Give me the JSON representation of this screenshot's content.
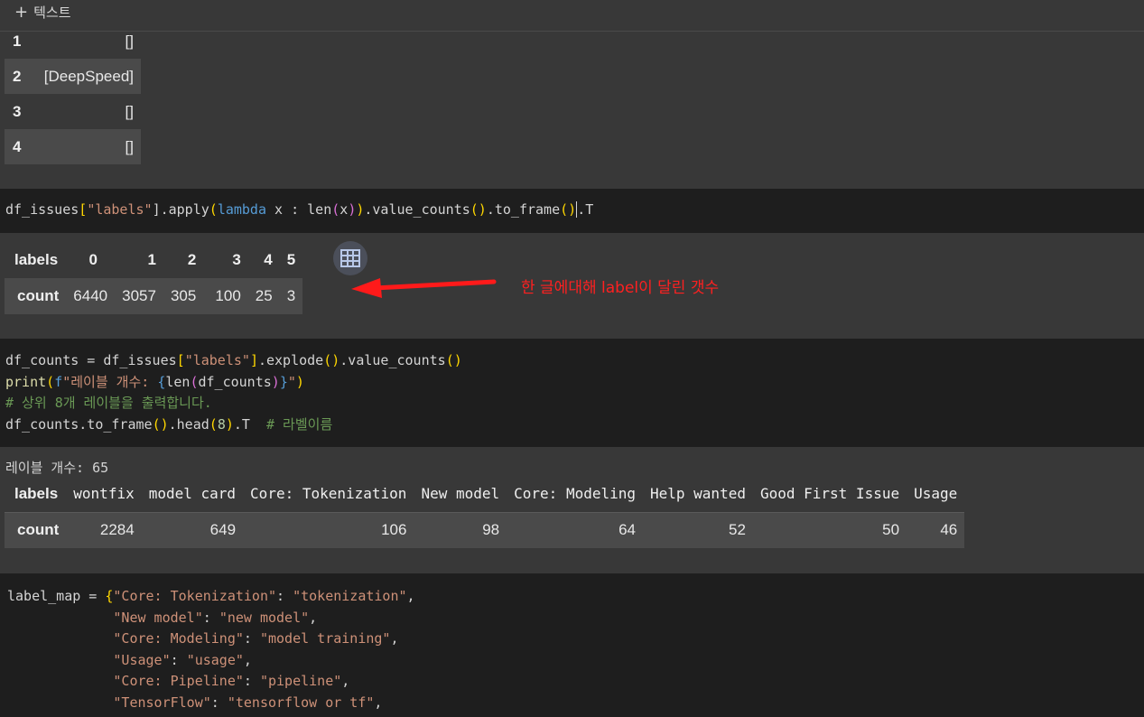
{
  "toolbar": {
    "add_text_label": "텍스트",
    "plus_icon": "plus-icon"
  },
  "prev_output": {
    "rows": [
      {
        "index": "1",
        "value": "[]"
      },
      {
        "index": "2",
        "value": "[DeepSpeed]"
      },
      {
        "index": "3",
        "value": "[]"
      },
      {
        "index": "4",
        "value": "[]"
      }
    ]
  },
  "cell1": {
    "code": {
      "a": "df_issues",
      "b": "[",
      "c": "\"labels\"",
      "d": "].apply",
      "e": "(",
      "f": "lambda",
      "g": " x : len",
      "h": "(",
      "i": "x",
      "j": ")",
      "k": ")",
      "l": ".value_counts",
      "m": "()",
      "n": ".to_frame",
      "o": "()",
      "p": ".T"
    }
  },
  "table1": {
    "header_label": "labels",
    "columns": [
      "0",
      "1",
      "2",
      "3",
      "4",
      "5"
    ],
    "row_label": "count",
    "values": [
      "6440",
      "3057",
      "305",
      "100",
      "25",
      "3"
    ]
  },
  "annotation": {
    "text": "한 글에대해 label이 달린 갯수",
    "color": "#ff2020"
  },
  "cell2": {
    "line1": {
      "a": "df_counts = df_issues",
      "b": "[",
      "c": "\"labels\"",
      "d": "]",
      "e": ".explode",
      "f": "()",
      "g": ".value_counts",
      "h": "()"
    },
    "line2": {
      "a": "print",
      "b": "(",
      "c": "f",
      "d": "\"레이블 개수: ",
      "e": "{",
      "f": "len",
      "g": "(",
      "h": "df_counts",
      "i": ")",
      "j": "}",
      "k": "\"",
      "l": ")"
    },
    "line3": "# 상위 8개 레이블을 출력합니다.",
    "line4": {
      "a": "df_counts.to_frame",
      "b": "()",
      "c": ".head",
      "d": "(",
      "e": "8",
      "f": ")",
      "g": ".T  ",
      "h": "# 라벨이름"
    }
  },
  "print_output": "레이블 개수: 65",
  "table2": {
    "header_label": "labels",
    "columns": [
      "wontfix",
      "model card",
      "Core: Tokenization",
      "New model",
      "Core: Modeling",
      "Help wanted",
      "Good First Issue",
      "Usage"
    ],
    "row_label": "count",
    "values": [
      "2284",
      "649",
      "106",
      "98",
      "64",
      "52",
      "50",
      "46"
    ]
  },
  "cell3": {
    "lines": [
      {
        "pre": "label_map = ",
        "brace": "{",
        "key": "\"Core: Tokenization\"",
        "colon": ": ",
        "val": "\"tokenization\"",
        "end": ","
      },
      {
        "pre": "             ",
        "brace": "",
        "key": "\"New model\"",
        "colon": ": ",
        "val": "\"new model\"",
        "end": ","
      },
      {
        "pre": "             ",
        "brace": "",
        "key": "\"Core: Modeling\"",
        "colon": ": ",
        "val": "\"model training\"",
        "end": ","
      },
      {
        "pre": "             ",
        "brace": "",
        "key": "\"Usage\"",
        "colon": ": ",
        "val": "\"usage\"",
        "end": ","
      },
      {
        "pre": "             ",
        "brace": "",
        "key": "\"Core: Pipeline\"",
        "colon": ": ",
        "val": "\"pipeline\"",
        "end": ","
      },
      {
        "pre": "             ",
        "brace": "",
        "key": "\"TensorFlow\"",
        "colon": ": ",
        "val": "\"tensorflow or tf\"",
        "end": ","
      }
    ]
  },
  "colors": {
    "background": "#383838",
    "code_background": "#1e1e1e",
    "string": "#ce9178",
    "keyword": "#569cd6",
    "comment": "#6a9955",
    "bracket": "#ffd700",
    "arrow": "#ff1a1a"
  }
}
